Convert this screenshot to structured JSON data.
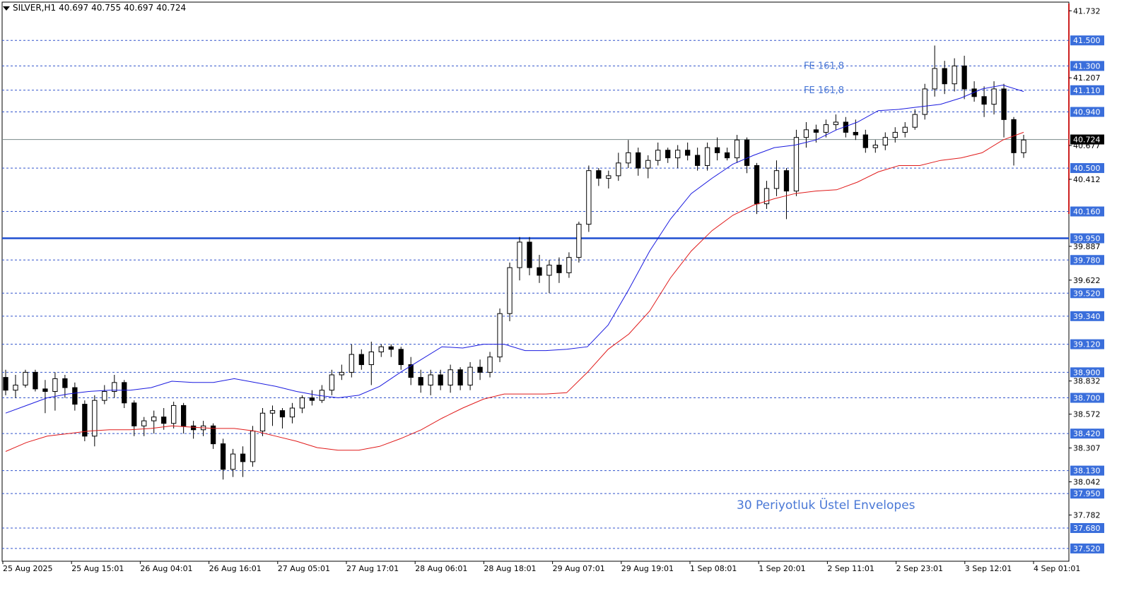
{
  "header": {
    "symbol": "SILVER,H1",
    "open": "40.697",
    "high": "40.755",
    "low": "40.697",
    "close": "40.724"
  },
  "chart_data": {
    "type": "candlestick",
    "ylim": [
      37.42,
      41.8
    ],
    "price_axis_ticks": [
      "41.732",
      "41.207",
      "40.677",
      "40.412",
      "39.887",
      "39.622",
      "38.832",
      "38.572",
      "38.307",
      "38.042",
      "37.782"
    ],
    "current_price": "40.724",
    "support_resistance_levels": [
      "41.500",
      "41.300",
      "41.110",
      "40.940",
      "40.500",
      "40.160",
      "39.950",
      "39.780",
      "39.520",
      "39.340",
      "39.120",
      "38.900",
      "38.700",
      "38.420",
      "38.130",
      "37.950",
      "37.680",
      "37.520"
    ],
    "highlighted_level": "39.950",
    "time_labels": [
      "25 Aug 2025",
      "25 Aug 15:01",
      "26 Aug 04:01",
      "26 Aug 16:01",
      "27 Aug 05:01",
      "27 Aug 17:01",
      "28 Aug 06:01",
      "28 Aug 18:01",
      "29 Aug 07:01",
      "29 Aug 19:01",
      "1 Sep 08:01",
      "1 Sep 20:01",
      "2 Sep 11:01",
      "2 Sep 23:01",
      "3 Sep 12:01",
      "4 Sep 01:01"
    ],
    "annotations": [
      "FE 161,8",
      "FE 161,8",
      "30 Periyotluk Üstel Envelopes"
    ],
    "colors": {
      "level_line": "#3355cc",
      "level_label_bg": "#3a6edb",
      "highlight_line": "#1e4fd1",
      "upper_envelope": "#1a1adf",
      "lower_envelope": "#e01a1a",
      "candle": "#000000",
      "annotation_text": "#4a78d6"
    },
    "series": [
      {
        "name": "upper",
        "values": [
          38.58,
          38.64,
          38.7,
          38.73,
          38.75,
          38.76,
          38.76,
          38.78,
          38.83,
          38.82,
          38.82,
          38.85,
          38.82,
          38.79,
          38.75,
          38.72,
          38.7,
          38.72,
          38.79,
          38.9,
          39.0,
          39.1,
          39.09,
          39.12,
          39.12,
          39.07,
          39.07,
          39.08,
          39.1,
          39.27,
          39.55,
          39.85,
          40.1,
          40.3,
          40.42,
          40.53,
          40.6,
          40.66,
          40.68,
          40.72,
          40.8,
          40.86,
          40.95,
          40.96,
          40.98,
          41.0,
          41.05,
          41.12,
          41.15,
          41.1
        ]
      },
      {
        "name": "lower",
        "values": [
          38.28,
          38.35,
          38.4,
          38.42,
          38.44,
          38.45,
          38.45,
          38.46,
          38.48,
          38.47,
          38.46,
          38.46,
          38.44,
          38.4,
          38.36,
          38.31,
          38.29,
          38.29,
          38.32,
          38.38,
          38.45,
          38.54,
          38.62,
          38.69,
          38.73,
          38.73,
          38.73,
          38.74,
          38.9,
          39.08,
          39.2,
          39.38,
          39.64,
          39.85,
          40.01,
          40.13,
          40.21,
          40.26,
          40.3,
          40.32,
          40.33,
          40.39,
          40.47,
          40.52,
          40.52,
          40.56,
          40.58,
          40.62,
          40.72,
          40.78
        ]
      },
      {
        "name": "candles",
        "values": [
          {
            "o": 38.86,
            "h": 38.92,
            "l": 38.72,
            "c": 38.76
          },
          {
            "o": 38.76,
            "h": 38.88,
            "l": 38.7,
            "c": 38.8
          },
          {
            "o": 38.8,
            "h": 38.92,
            "l": 38.78,
            "c": 38.9
          },
          {
            "o": 38.9,
            "h": 38.92,
            "l": 38.75,
            "c": 38.77
          },
          {
            "o": 38.77,
            "h": 38.84,
            "l": 38.58,
            "c": 38.75
          },
          {
            "o": 38.75,
            "h": 38.9,
            "l": 38.6,
            "c": 38.85
          },
          {
            "o": 38.85,
            "h": 38.88,
            "l": 38.7,
            "c": 38.78
          },
          {
            "o": 38.78,
            "h": 38.82,
            "l": 38.6,
            "c": 38.65
          },
          {
            "o": 38.65,
            "h": 38.68,
            "l": 38.36,
            "c": 38.4
          },
          {
            "o": 38.4,
            "h": 38.72,
            "l": 38.32,
            "c": 38.68
          },
          {
            "o": 38.68,
            "h": 38.8,
            "l": 38.65,
            "c": 38.75
          },
          {
            "o": 38.75,
            "h": 38.88,
            "l": 38.7,
            "c": 38.82
          },
          {
            "o": 38.82,
            "h": 38.84,
            "l": 38.62,
            "c": 38.66
          },
          {
            "o": 38.66,
            "h": 38.68,
            "l": 38.4,
            "c": 38.48
          },
          {
            "o": 38.48,
            "h": 38.55,
            "l": 38.4,
            "c": 38.52
          },
          {
            "o": 38.52,
            "h": 38.6,
            "l": 38.42,
            "c": 38.55
          },
          {
            "o": 38.55,
            "h": 38.62,
            "l": 38.45,
            "c": 38.5
          },
          {
            "o": 38.5,
            "h": 38.67,
            "l": 38.46,
            "c": 38.64
          },
          {
            "o": 38.64,
            "h": 38.66,
            "l": 38.42,
            "c": 38.48
          },
          {
            "o": 38.48,
            "h": 38.52,
            "l": 38.38,
            "c": 38.45
          },
          {
            "o": 38.45,
            "h": 38.52,
            "l": 38.4,
            "c": 38.48
          },
          {
            "o": 38.48,
            "h": 38.5,
            "l": 38.3,
            "c": 38.34
          },
          {
            "o": 38.34,
            "h": 38.38,
            "l": 38.06,
            "c": 38.14
          },
          {
            "o": 38.14,
            "h": 38.3,
            "l": 38.08,
            "c": 38.26
          },
          {
            "o": 38.26,
            "h": 38.32,
            "l": 38.08,
            "c": 38.2
          },
          {
            "o": 38.2,
            "h": 38.48,
            "l": 38.16,
            "c": 38.44
          },
          {
            "o": 38.44,
            "h": 38.62,
            "l": 38.4,
            "c": 38.58
          },
          {
            "o": 38.58,
            "h": 38.64,
            "l": 38.48,
            "c": 38.6
          },
          {
            "o": 38.6,
            "h": 38.62,
            "l": 38.46,
            "c": 38.55
          },
          {
            "o": 38.55,
            "h": 38.66,
            "l": 38.5,
            "c": 38.62
          },
          {
            "o": 38.62,
            "h": 38.72,
            "l": 38.58,
            "c": 38.7
          },
          {
            "o": 38.7,
            "h": 38.76,
            "l": 38.64,
            "c": 38.68
          },
          {
            "o": 38.68,
            "h": 38.8,
            "l": 38.66,
            "c": 38.76
          },
          {
            "o": 38.76,
            "h": 38.92,
            "l": 38.72,
            "c": 38.88
          },
          {
            "o": 38.88,
            "h": 38.96,
            "l": 38.84,
            "c": 38.9
          },
          {
            "o": 38.9,
            "h": 39.12,
            "l": 38.86,
            "c": 39.04
          },
          {
            "o": 39.04,
            "h": 39.08,
            "l": 38.92,
            "c": 38.96
          },
          {
            "o": 38.96,
            "h": 39.14,
            "l": 38.8,
            "c": 39.06
          },
          {
            "o": 39.06,
            "h": 39.12,
            "l": 39.02,
            "c": 39.1
          },
          {
            "o": 39.1,
            "h": 39.12,
            "l": 39.02,
            "c": 39.08
          },
          {
            "o": 39.08,
            "h": 39.1,
            "l": 38.92,
            "c": 38.96
          },
          {
            "o": 38.96,
            "h": 39.02,
            "l": 38.8,
            "c": 38.86
          },
          {
            "o": 38.86,
            "h": 38.92,
            "l": 38.74,
            "c": 38.8
          },
          {
            "o": 38.8,
            "h": 38.92,
            "l": 38.72,
            "c": 38.88
          },
          {
            "o": 38.88,
            "h": 38.92,
            "l": 38.76,
            "c": 38.8
          },
          {
            "o": 38.8,
            "h": 38.96,
            "l": 38.74,
            "c": 38.92
          },
          {
            "o": 38.92,
            "h": 38.94,
            "l": 38.76,
            "c": 38.8
          },
          {
            "o": 38.8,
            "h": 38.98,
            "l": 38.76,
            "c": 38.94
          },
          {
            "o": 38.94,
            "h": 39.0,
            "l": 38.84,
            "c": 38.9
          },
          {
            "o": 38.9,
            "h": 39.06,
            "l": 38.86,
            "c": 39.02
          },
          {
            "o": 39.02,
            "h": 39.4,
            "l": 38.98,
            "c": 39.36
          },
          {
            "o": 39.36,
            "h": 39.76,
            "l": 39.3,
            "c": 39.72
          },
          {
            "o": 39.72,
            "h": 39.96,
            "l": 39.62,
            "c": 39.92
          },
          {
            "o": 39.92,
            "h": 39.96,
            "l": 39.66,
            "c": 39.72
          },
          {
            "o": 39.72,
            "h": 39.82,
            "l": 39.6,
            "c": 39.66
          },
          {
            "o": 39.66,
            "h": 39.78,
            "l": 39.52,
            "c": 39.74
          },
          {
            "o": 39.74,
            "h": 39.8,
            "l": 39.6,
            "c": 39.68
          },
          {
            "o": 39.68,
            "h": 39.84,
            "l": 39.64,
            "c": 39.8
          },
          {
            "o": 39.8,
            "h": 40.08,
            "l": 39.76,
            "c": 40.06
          },
          {
            "o": 40.06,
            "h": 40.52,
            "l": 40.0,
            "c": 40.48
          },
          {
            "o": 40.48,
            "h": 40.5,
            "l": 40.36,
            "c": 40.42
          },
          {
            "o": 40.42,
            "h": 40.48,
            "l": 40.34,
            "c": 40.44
          },
          {
            "o": 40.44,
            "h": 40.62,
            "l": 40.4,
            "c": 40.54
          },
          {
            "o": 40.54,
            "h": 40.72,
            "l": 40.5,
            "c": 40.62
          },
          {
            "o": 40.62,
            "h": 40.66,
            "l": 40.44,
            "c": 40.5
          },
          {
            "o": 40.5,
            "h": 40.6,
            "l": 40.42,
            "c": 40.56
          },
          {
            "o": 40.56,
            "h": 40.7,
            "l": 40.52,
            "c": 40.64
          },
          {
            "o": 40.64,
            "h": 40.66,
            "l": 40.54,
            "c": 40.58
          },
          {
            "o": 40.58,
            "h": 40.68,
            "l": 40.5,
            "c": 40.64
          },
          {
            "o": 40.64,
            "h": 40.7,
            "l": 40.56,
            "c": 40.6
          },
          {
            "o": 40.6,
            "h": 40.66,
            "l": 40.48,
            "c": 40.52
          },
          {
            "o": 40.52,
            "h": 40.7,
            "l": 40.48,
            "c": 40.66
          },
          {
            "o": 40.66,
            "h": 40.74,
            "l": 40.56,
            "c": 40.62
          },
          {
            "o": 40.62,
            "h": 40.66,
            "l": 40.56,
            "c": 40.58
          },
          {
            "o": 40.58,
            "h": 40.76,
            "l": 40.54,
            "c": 40.72
          },
          {
            "o": 40.72,
            "h": 40.74,
            "l": 40.46,
            "c": 40.52
          },
          {
            "o": 40.52,
            "h": 40.54,
            "l": 40.14,
            "c": 40.22
          },
          {
            "o": 40.22,
            "h": 40.4,
            "l": 40.18,
            "c": 40.34
          },
          {
            "o": 40.34,
            "h": 40.56,
            "l": 40.28,
            "c": 40.48
          },
          {
            "o": 40.48,
            "h": 40.5,
            "l": 40.1,
            "c": 40.32
          },
          {
            "o": 40.32,
            "h": 40.8,
            "l": 40.28,
            "c": 40.74
          },
          {
            "o": 40.74,
            "h": 40.86,
            "l": 40.66,
            "c": 40.8
          },
          {
            "o": 40.8,
            "h": 40.84,
            "l": 40.7,
            "c": 40.78
          },
          {
            "o": 40.78,
            "h": 40.88,
            "l": 40.74,
            "c": 40.84
          },
          {
            "o": 40.84,
            "h": 40.92,
            "l": 40.8,
            "c": 40.86
          },
          {
            "o": 40.86,
            "h": 40.9,
            "l": 40.74,
            "c": 40.78
          },
          {
            "o": 40.78,
            "h": 40.88,
            "l": 40.72,
            "c": 40.76
          },
          {
            "o": 40.76,
            "h": 40.8,
            "l": 40.62,
            "c": 40.66
          },
          {
            "o": 40.66,
            "h": 40.72,
            "l": 40.62,
            "c": 40.68
          },
          {
            "o": 40.68,
            "h": 40.78,
            "l": 40.64,
            "c": 40.74
          },
          {
            "o": 40.74,
            "h": 40.82,
            "l": 40.7,
            "c": 40.78
          },
          {
            "o": 40.78,
            "h": 40.86,
            "l": 40.74,
            "c": 40.82
          },
          {
            "o": 40.82,
            "h": 40.96,
            "l": 40.8,
            "c": 40.92
          },
          {
            "o": 40.92,
            "h": 41.16,
            "l": 40.88,
            "c": 41.12
          },
          {
            "o": 41.12,
            "h": 41.46,
            "l": 41.06,
            "c": 41.28
          },
          {
            "o": 41.28,
            "h": 41.34,
            "l": 41.08,
            "c": 41.16
          },
          {
            "o": 41.16,
            "h": 41.36,
            "l": 41.1,
            "c": 41.3
          },
          {
            "o": 41.3,
            "h": 41.38,
            "l": 41.04,
            "c": 41.12
          },
          {
            "o": 41.12,
            "h": 41.18,
            "l": 41.02,
            "c": 41.06
          },
          {
            "o": 41.06,
            "h": 41.14,
            "l": 40.9,
            "c": 41.0
          },
          {
            "o": 41.0,
            "h": 41.18,
            "l": 40.92,
            "c": 41.12
          },
          {
            "o": 41.12,
            "h": 41.16,
            "l": 40.74,
            "c": 40.88
          },
          {
            "o": 40.88,
            "h": 40.9,
            "l": 40.52,
            "c": 40.62
          },
          {
            "o": 40.62,
            "h": 40.76,
            "l": 40.58,
            "c": 40.72
          }
        ]
      }
    ]
  }
}
